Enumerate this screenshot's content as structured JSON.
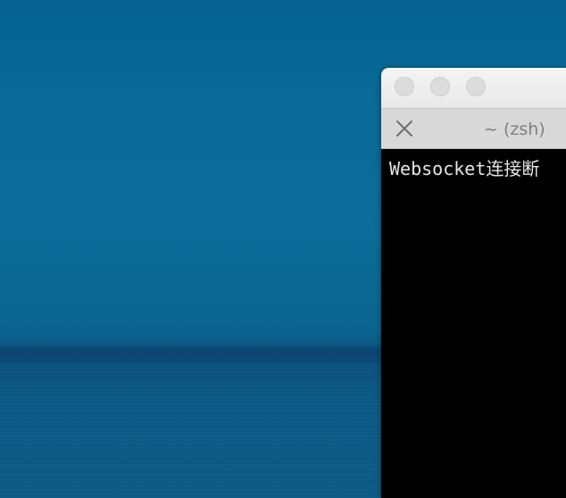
{
  "colors": {
    "desktop_sky": "#0a6a98",
    "desktop_sea": "#0c5b87",
    "titlebar": "#ececec",
    "tabbar": "#d8d8d8",
    "terminal_bg": "#000000",
    "terminal_fg": "#e6e6e6",
    "tab_title": "#808080"
  },
  "window": {
    "controls": [
      "close-button",
      "minimize-button",
      "zoom-button"
    ],
    "tab": {
      "close_icon": "close-icon",
      "title": "~ (zsh)"
    }
  },
  "terminal": {
    "output_line": "Websocket连接断"
  }
}
